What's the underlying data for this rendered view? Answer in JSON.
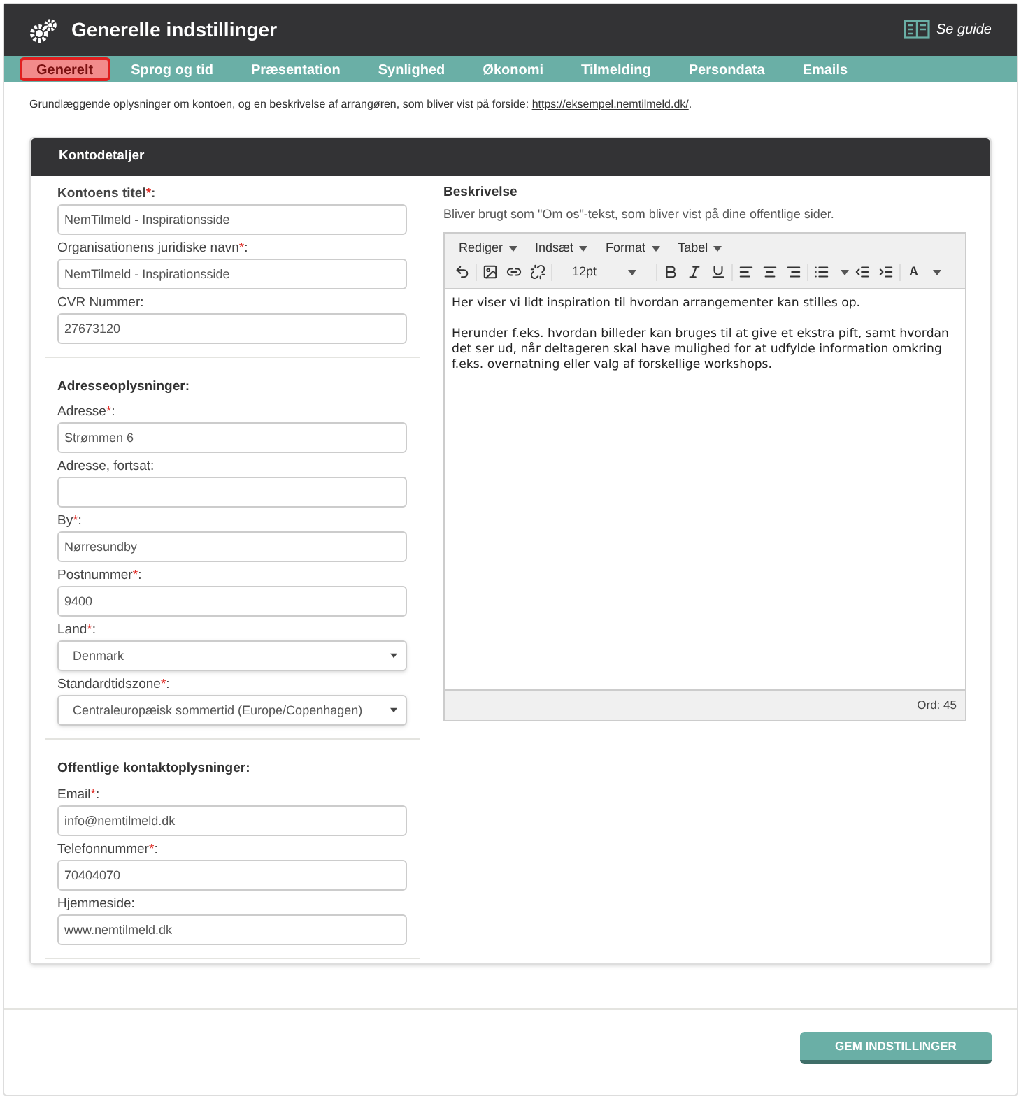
{
  "header": {
    "title": "Generelle indstillinger",
    "guide_link": "Se guide"
  },
  "tabs": [
    {
      "label": "Generelt",
      "selected": true
    },
    {
      "label": "Sprog og tid",
      "selected": false
    },
    {
      "label": "Præsentation",
      "selected": false
    },
    {
      "label": "Synlighed",
      "selected": false
    },
    {
      "label": "Økonomi",
      "selected": false
    },
    {
      "label": "Tilmelding",
      "selected": false
    },
    {
      "label": "Persondata",
      "selected": false
    },
    {
      "label": "Emails",
      "selected": false
    }
  ],
  "intro": {
    "text": "Grundlæggende oplysninger om kontoen, og en beskrivelse af arrangøren, som bliver vist på forside:",
    "link": "https://eksempel.nemtilmeld.dk/",
    "after": "."
  },
  "panel": {
    "title": "Kontodetaljer",
    "sections": [
      {
        "fields": [
          {
            "kind": "text",
            "label": "Kontoens titel",
            "bold": true,
            "required": true,
            "mark": "*",
            "suffix": ":",
            "value": "NemTilmeld - Inspirationsside"
          },
          {
            "kind": "text",
            "label": "Organisationens juridiske navn",
            "required": true,
            "mark": "*",
            "suffix": ":",
            "value": "NemTilmeld - Inspirationsside"
          },
          {
            "kind": "text",
            "label": "CVR Nummer:",
            "value": "27673120"
          }
        ]
      },
      {
        "heading": "Adresseoplysninger:",
        "fields": [
          {
            "kind": "text",
            "label": "Adresse",
            "required": true,
            "mark": "*",
            "suffix": ":",
            "value": "Strømmen 6"
          },
          {
            "kind": "text",
            "label": "Adresse, fortsat:"
          },
          {
            "kind": "text",
            "label": "By",
            "required": true,
            "mark": "*",
            "suffix": ":",
            "value": "Nørresundby"
          },
          {
            "kind": "text",
            "label": "Postnummer",
            "required": true,
            "mark": "*",
            "suffix": ":",
            "value": "9400"
          },
          {
            "kind": "select",
            "label": "Land",
            "required": true,
            "mark": "*",
            "suffix": ":",
            "value": "Denmark"
          },
          {
            "kind": "select",
            "label": "Standardtidszone",
            "required": true,
            "mark": "*",
            "suffix": ":",
            "value": "Centraleuropæisk sommertid (Europe/Copenhagen)"
          }
        ]
      },
      {
        "heading": "Offentlige kontaktoplysninger:",
        "fields": [
          {
            "kind": "text",
            "label": "Email",
            "required": true,
            "mark": "*",
            "suffix": ":",
            "value": "info@nemtilmeld.dk"
          },
          {
            "kind": "text",
            "label": "Telefonnummer",
            "required": true,
            "mark": "*",
            "suffix": ":",
            "value": "70404070"
          },
          {
            "kind": "text",
            "label": "Hjemmeside:",
            "value": "www.nemtilmeld.dk"
          }
        ]
      }
    ],
    "description": {
      "title": "Beskrivelse",
      "hint": "Bliver brugt som \"Om os\"-tekst, som bliver vist på dine offentlige sider.",
      "menus": [
        "Rediger",
        "Indsæt",
        "Format",
        "Tabel"
      ],
      "font_size": "12pt",
      "text_color": "A",
      "paragraphs": [
        "Her viser vi lidt inspiration til hvordan arrangementer kan stilles op.",
        "Herunder f.eks. hvordan billeder kan bruges til at give et ekstra pift, samt hvordan det ser ud, når deltageren skal have mulighed for at udfylde information omkring f.eks. overnatning eller valg af forskellige workshops."
      ],
      "word_count": "Ord: 45"
    }
  },
  "save_button": "GEM INDSTILLINGER"
}
